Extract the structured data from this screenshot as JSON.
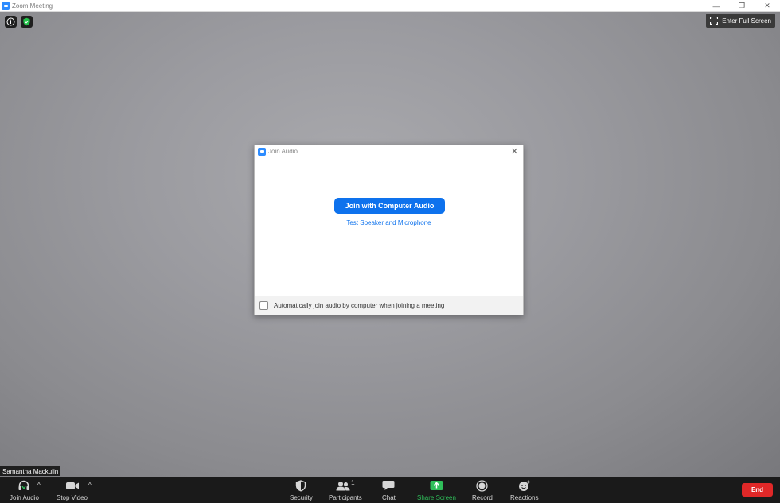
{
  "window": {
    "title": "Zoom Meeting",
    "controls": {
      "minimize": "—",
      "restore": "❐",
      "close": "✕"
    }
  },
  "video": {
    "fullscreen_label": "Enter Full Screen",
    "participant_name": "Samantha Mackulin"
  },
  "dialog": {
    "title": "Join Audio",
    "close": "✕",
    "primary_button": "Join with Computer Audio",
    "test_link": "Test Speaker and Microphone",
    "auto_join_label": "Automatically join audio by computer when joining a meeting"
  },
  "toolbar": {
    "join_audio": "Join Audio",
    "stop_video": "Stop Video",
    "security": "Security",
    "participants": "Participants",
    "participant_count": "1",
    "chat": "Chat",
    "share_screen": "Share Screen",
    "record": "Record",
    "reactions": "Reactions",
    "end": "End",
    "caret": "^"
  },
  "colors": {
    "accent": "#0e72ed",
    "share_green": "#2fbf5a",
    "end_red": "#e02828",
    "toolbar_bg": "#1a1a1a"
  }
}
